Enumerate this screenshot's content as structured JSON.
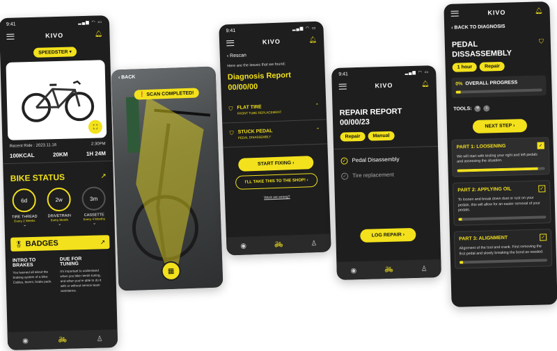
{
  "app": {
    "logo": "KIVO",
    "time": "9:41"
  },
  "screen1": {
    "model_label": "SPEEDSTER",
    "recent_ride": "Recent Ride : 2023.11.16",
    "ride_time": "2:30PM",
    "stats": [
      "100KCAL",
      "20KM",
      "1H 24M"
    ],
    "bike_status_title": "BIKE STATUS",
    "dials": [
      {
        "value": "6d",
        "label": "TIRE THREAD",
        "sub": "Every 2 Weeks"
      },
      {
        "value": "2w",
        "label": "DRIVETRAIN",
        "sub": "Every Month"
      },
      {
        "value": "3m",
        "label": "CASSETTE",
        "sub": "Every 4 Months"
      }
    ],
    "badges_title": "BADGES",
    "badges": [
      {
        "title": "INTRO TO BRAKES",
        "desc": "You learned all about the braking system of a bike: Cables, levers, brake pads."
      },
      {
        "title": "DUE FOR TUNING",
        "desc": "It's important to understand when you bike needs tuning, and when you're able to do it with or without service team assistance."
      }
    ]
  },
  "screen2": {
    "back_label": "BACK",
    "scan_label": "SCAN COMPLETED!"
  },
  "screen3": {
    "rescan_label": "Rescan",
    "intro": "Here are the issues that we found:",
    "title": "Diagnosis Report",
    "date": "00/00/00",
    "issues": [
      {
        "title": "FLAT TIRE",
        "sub": "FRONT TUBE REPLACEMENT"
      },
      {
        "title": "STUCK PEDAL",
        "sub": "PEDAL DISASSEMBLY"
      }
    ],
    "start_label": "START FIXING",
    "shop_label": "I'LL TAKE THIS TO THE SHOP!",
    "wrong_link": "Were we wrong?"
  },
  "screen4": {
    "title": "REPAIR REPORT",
    "date": "00/00/23",
    "tags": [
      "Repair",
      "Manual"
    ],
    "items": [
      "Pedal Disassembly",
      "Tire replacement"
    ],
    "log_label": "LOG REPAIR"
  },
  "screen5": {
    "back_label": "BACK TO DIAGNOSIS",
    "title": "PEDAL DISSASSEMBLY",
    "tags": [
      "1 hour",
      "Repair"
    ],
    "progress_value": "0%",
    "progress_label": "OVERALL PROGRESS",
    "progress_fraction": 0.06,
    "tools_label": "TOOLS:",
    "next_label": "NEXT STEP",
    "parts": [
      {
        "title": "PART 1: LOOSENING",
        "desc": "We will start with testing your right and left pedals and assessing the situation.",
        "checked": true,
        "fill": 0.92
      },
      {
        "title": "PART 2: APPLYING OIL",
        "desc": "To loosen and break down dust or rust on your pedals, this will allow for an easier removal of your pedals.",
        "checked": false,
        "fill": 0.04
      },
      {
        "title": "PART 3: ALIGNMENT",
        "desc": "Alignment of the tool and crank. First removing the first pedal and slowly breaking the bond as needed.",
        "checked": false,
        "fill": 0.04
      }
    ]
  },
  "colors": {
    "accent": "#f2e11c",
    "bg": "#1e1e1e"
  }
}
